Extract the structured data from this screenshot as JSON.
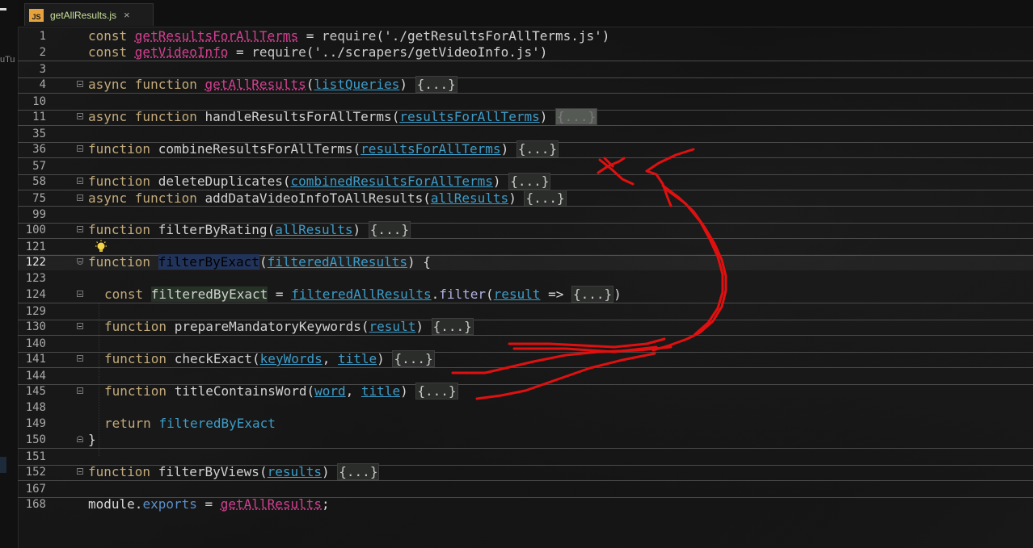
{
  "tab": {
    "icon_label": "JS",
    "file_name": "getAllResults.js",
    "close_symbol": "×"
  },
  "sidebar": {
    "cut_text": "uTu"
  },
  "editor": {
    "lines": [
      {
        "n": "1",
        "tokens": [
          [
            "kw",
            "const "
          ],
          [
            "fnref",
            "getResultsForAllTerms"
          ],
          [
            "plain",
            " = "
          ],
          [
            "req",
            "require"
          ],
          [
            "plain",
            "("
          ],
          [
            "str",
            "'./getResultsForAllTerms.js'"
          ],
          [
            "plain",
            ")"
          ]
        ]
      },
      {
        "n": "2",
        "tokens": [
          [
            "kw",
            "const "
          ],
          [
            "fnref",
            "getVideoInfo"
          ],
          [
            "plain",
            " = "
          ],
          [
            "req",
            "require"
          ],
          [
            "plain",
            "("
          ],
          [
            "str",
            "'../scrapers/getVideoInfo.js'"
          ],
          [
            "plain",
            ")"
          ]
        ]
      },
      {
        "n": "3",
        "tokens": []
      },
      {
        "n": "4",
        "tokens": [
          [
            "kw",
            "async function "
          ],
          [
            "fnref",
            "getAllResults"
          ],
          [
            "plain",
            "("
          ],
          [
            "param",
            "listQueries"
          ],
          [
            "plain",
            ") "
          ],
          [
            "ellip",
            "{...}"
          ]
        ]
      },
      {
        "n": "10",
        "tokens": []
      },
      {
        "n": "11",
        "tokens": [
          [
            "kw",
            "async function "
          ],
          [
            "fn",
            "handleResultsForAllTerms"
          ],
          [
            "plain",
            "("
          ],
          [
            "param",
            "resultsForAllTerms"
          ],
          [
            "plain",
            ") "
          ],
          [
            "ghost",
            "{...}"
          ]
        ]
      },
      {
        "n": "35",
        "tokens": []
      },
      {
        "n": "36",
        "tokens": [
          [
            "kw",
            "function "
          ],
          [
            "fn",
            "combineResultsForAllTerms"
          ],
          [
            "plain",
            "("
          ],
          [
            "param",
            "resultsForAllTerms"
          ],
          [
            "plain",
            ") "
          ],
          [
            "ellip",
            "{...}"
          ]
        ]
      },
      {
        "n": "57",
        "tokens": []
      },
      {
        "n": "58",
        "tokens": [
          [
            "kw",
            "function "
          ],
          [
            "fn",
            "deleteDuplicates"
          ],
          [
            "plain",
            "("
          ],
          [
            "param",
            "combinedResultsForAllTerms"
          ],
          [
            "plain",
            ") "
          ],
          [
            "ellip",
            "{...}"
          ]
        ]
      },
      {
        "n": "75",
        "tokens": [
          [
            "kw",
            "async function "
          ],
          [
            "fn",
            "addDataVideoInfoToAllResults"
          ],
          [
            "plain",
            "("
          ],
          [
            "param",
            "allResults"
          ],
          [
            "plain",
            ") "
          ],
          [
            "ellip",
            "{...}"
          ]
        ]
      },
      {
        "n": "99",
        "tokens": []
      },
      {
        "n": "100",
        "tokens": [
          [
            "kw",
            "function "
          ],
          [
            "fn",
            "filterByRating"
          ],
          [
            "plain",
            "("
          ],
          [
            "param",
            "allResults"
          ],
          [
            "plain",
            ") "
          ],
          [
            "ellip",
            "{...}"
          ]
        ]
      },
      {
        "n": "121",
        "tokens": []
      },
      {
        "n": "122",
        "tokens": [
          [
            "kw",
            "function "
          ],
          [
            "selword",
            "filterByExact"
          ],
          [
            "plain",
            "("
          ],
          [
            "param",
            "filteredAllResults"
          ],
          [
            "plain",
            ") {"
          ]
        ]
      },
      {
        "n": "123",
        "tokens": []
      },
      {
        "n": "124",
        "tokens": [
          [
            "kw",
            "const "
          ],
          [
            "hl",
            "filteredByExact"
          ],
          [
            "plain",
            " = "
          ],
          [
            "param",
            "filteredAllResults"
          ],
          [
            "plain",
            "."
          ],
          [
            "filt",
            "filter"
          ],
          [
            "plain",
            "("
          ],
          [
            "param",
            "result"
          ],
          [
            "plain",
            " => "
          ],
          [
            "ellip",
            "{...}"
          ],
          [
            "plain",
            ")"
          ]
        ]
      },
      {
        "n": "129",
        "tokens": []
      },
      {
        "n": "130",
        "tokens": [
          [
            "kw",
            "function "
          ],
          [
            "fn",
            "prepareMandatoryKeywords"
          ],
          [
            "plain",
            "("
          ],
          [
            "param",
            "result"
          ],
          [
            "plain",
            ") "
          ],
          [
            "ellip",
            "{...}"
          ]
        ]
      },
      {
        "n": "140",
        "tokens": []
      },
      {
        "n": "141",
        "tokens": [
          [
            "kw",
            "function "
          ],
          [
            "fn",
            "checkExact"
          ],
          [
            "plain",
            "("
          ],
          [
            "param",
            "keyWords"
          ],
          [
            "plain",
            ", "
          ],
          [
            "param",
            "title"
          ],
          [
            "plain",
            ") "
          ],
          [
            "ellip",
            "{...}"
          ]
        ]
      },
      {
        "n": "144",
        "tokens": []
      },
      {
        "n": "145",
        "tokens": [
          [
            "kw",
            "function "
          ],
          [
            "fn",
            "titleContainsWord"
          ],
          [
            "plain",
            "("
          ],
          [
            "param",
            "word"
          ],
          [
            "plain",
            ", "
          ],
          [
            "param",
            "title"
          ],
          [
            "plain",
            ") "
          ],
          [
            "ellip",
            "{...}"
          ]
        ]
      },
      {
        "n": "148",
        "tokens": []
      },
      {
        "n": "149",
        "tokens": [
          [
            "kw",
            "return "
          ],
          [
            "local",
            "filteredByExact"
          ]
        ]
      },
      {
        "n": "150",
        "tokens": [
          [
            "plain",
            "}"
          ]
        ]
      },
      {
        "n": "151",
        "tokens": []
      },
      {
        "n": "152",
        "tokens": [
          [
            "kw",
            "function "
          ],
          [
            "fn",
            "filterByViews"
          ],
          [
            "plain",
            "("
          ],
          [
            "param",
            "results"
          ],
          [
            "plain",
            ") "
          ],
          [
            "ellip",
            "{...}"
          ]
        ]
      },
      {
        "n": "167",
        "tokens": []
      },
      {
        "n": "168",
        "tokens": [
          [
            "plain",
            "module"
          ],
          [
            "plain",
            "."
          ],
          [
            "prop",
            "exports"
          ],
          [
            "plain",
            " = "
          ],
          [
            "fnref",
            "getAllResults"
          ],
          [
            "plain",
            ";"
          ]
        ]
      }
    ]
  },
  "colors": {
    "annotation": "#e01010",
    "keyword": "#c2aa7a",
    "param": "#3d9cc8",
    "fnref": "#d0408f"
  }
}
